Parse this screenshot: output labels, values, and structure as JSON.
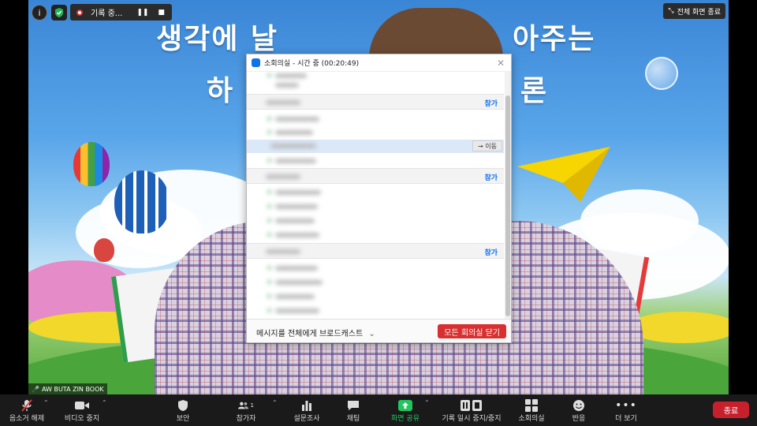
{
  "top_bar": {
    "info_icon": "info-icon",
    "security_shield_icon": "shield-check-icon",
    "recording": {
      "status_label": "기록 중...",
      "pause_icon": "pause-icon",
      "stop_icon": "stop-icon"
    },
    "view_button_label": "전체 화면 종료"
  },
  "video": {
    "headline_line1": "생각에 날",
    "headline_line1_right": "아주는",
    "headline_line2_left": "하",
    "headline_line2_right": "론",
    "participant_name": "AW BUTA ZIN BOOK"
  },
  "breakout_dialog": {
    "title": "소회의실 - 시간 중 (00:20:49)",
    "close_icon": "close-icon",
    "rooms": [
      {
        "join_label": "참가"
      },
      {
        "join_label": "참가"
      },
      {
        "join_label": "참가"
      }
    ],
    "move_button_label": "→ 이동",
    "broadcast_label": "메시지를 전체에게 브로드캐스트",
    "close_all_label": "모든 회의실 닫기"
  },
  "toolbar": {
    "items": [
      {
        "label": "음소거 해제",
        "icon": "mic-muted-icon"
      },
      {
        "label": "비디오 중지",
        "icon": "video-camera-icon"
      },
      {
        "label": "보안",
        "icon": "shield-icon"
      },
      {
        "label": "참가자",
        "icon": "participants-icon",
        "count": "1"
      },
      {
        "label": "설문조사",
        "icon": "bar-chart-icon"
      },
      {
        "label": "채팅",
        "icon": "chat-icon"
      },
      {
        "label": "화면 공유",
        "icon": "share-screen-icon"
      },
      {
        "label": "기록 일시 중지/중지",
        "icon": "pause-stop-icon"
      },
      {
        "label": "소회의실",
        "icon": "grid-icon"
      },
      {
        "label": "반응",
        "icon": "emoji-icon"
      },
      {
        "label": "더 보기",
        "icon": "more-icon"
      }
    ],
    "end_label": "종료"
  },
  "colors": {
    "accent_blue": "#0e72ed",
    "end_red": "#c7202d",
    "share_green": "#22c55e",
    "toolbar_bg": "#1a1a1a"
  }
}
